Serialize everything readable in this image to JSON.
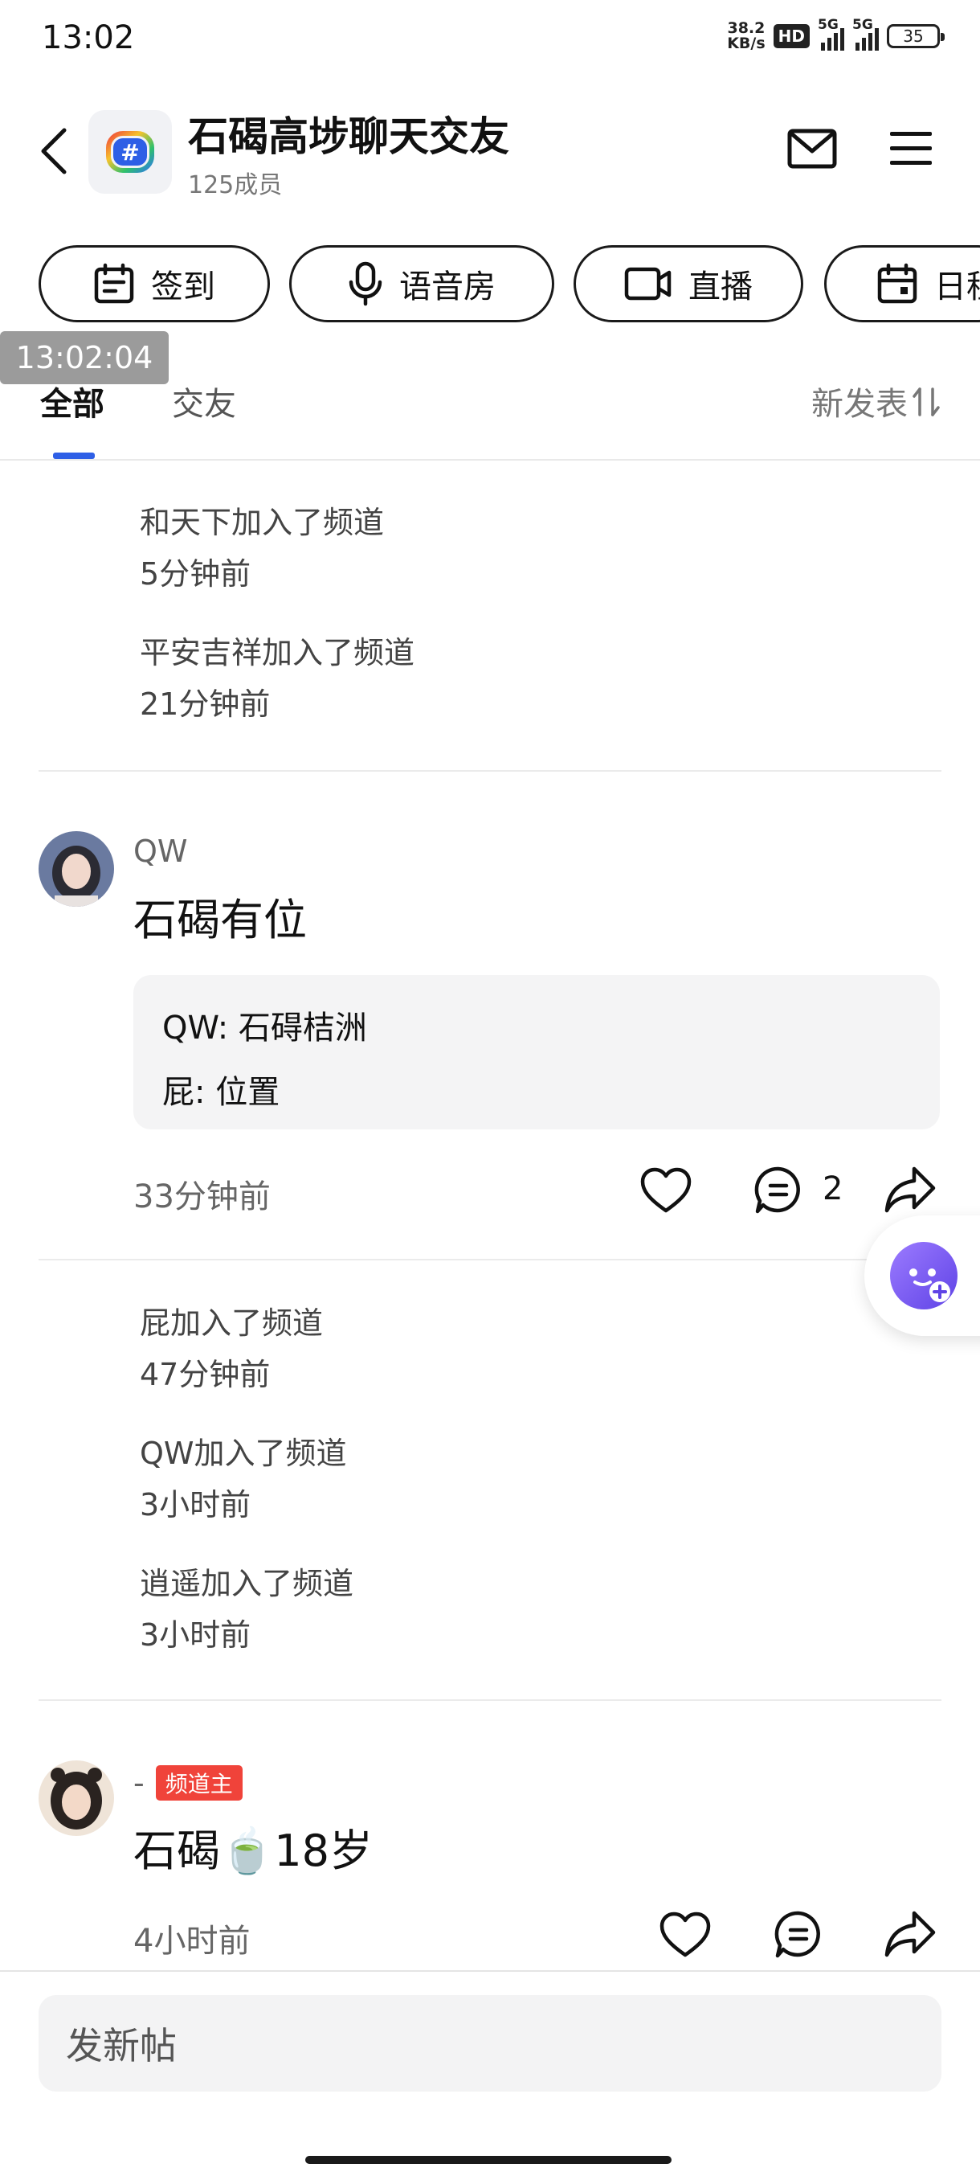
{
  "status_bar": {
    "time": "13:02",
    "net_speed_value": "38.2",
    "net_speed_unit": "KB/s",
    "hd_label": "HD",
    "signal1_label": "5G",
    "signal2_label": "5G",
    "battery": "35"
  },
  "header": {
    "title": "石碣高埗聊天交友",
    "members": "125成员"
  },
  "quick_buttons": [
    {
      "label": "签到",
      "icon": "calendar-icon"
    },
    {
      "label": "语音房",
      "icon": "microphone-icon"
    },
    {
      "label": "直播",
      "icon": "video-camera-icon"
    },
    {
      "label": "日程",
      "icon": "calendar-icon"
    }
  ],
  "time_overlay": "13:02:04",
  "tabs": [
    {
      "label": "全部",
      "active": true
    },
    {
      "label": "交友",
      "active": false
    }
  ],
  "sort_label": "新发表",
  "system_group1": [
    {
      "text": "和天下加入了频道",
      "time": "5分钟前"
    },
    {
      "text": "平安吉祥加入了频道",
      "time": "21分钟前"
    }
  ],
  "post1": {
    "username": "QW",
    "content": "石碣有位",
    "comments": [
      {
        "author": "QW",
        "text": "石碍桔洲"
      },
      {
        "author": "屁",
        "text": "位置"
      }
    ],
    "time": "33分钟前",
    "comment_count": "2"
  },
  "system_group2": [
    {
      "text": "屁加入了频道",
      "time": "47分钟前"
    },
    {
      "text": "QW加入了频道",
      "time": "3小时前"
    },
    {
      "text": "逍遥加入了频道",
      "time": "3小时前"
    }
  ],
  "post2": {
    "username": "-",
    "badge": "频道主",
    "content_before": "石碣",
    "emoji": "🍵",
    "content_after": "18岁",
    "time": "4小时前"
  },
  "composer": {
    "placeholder": "发新帖"
  },
  "colors": {
    "accent": "#2e5fe6",
    "badge": "#f0433a",
    "float_button": "#7b5cf0"
  }
}
